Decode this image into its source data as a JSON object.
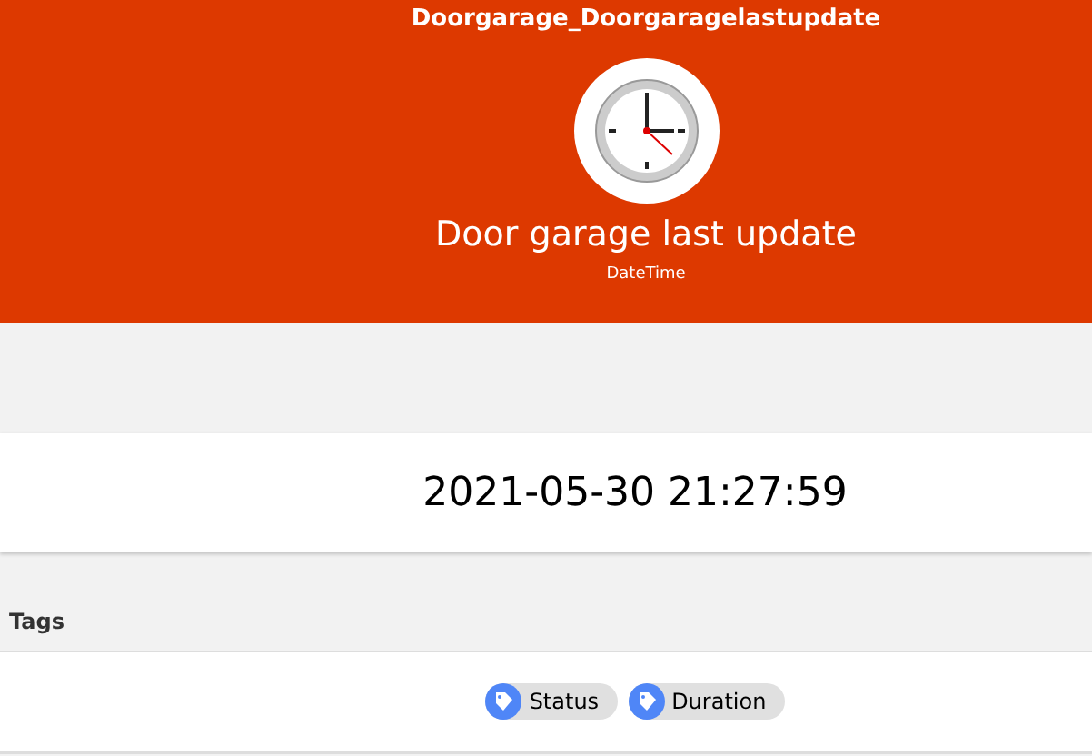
{
  "header": {
    "item_name": "Doorgarage_Doorgaragelastupdate",
    "label": "Door garage last update",
    "type": "DateTime"
  },
  "state": {
    "value": "2021-05-30 21:27:59"
  },
  "tags": {
    "heading": "Tags",
    "items": [
      {
        "label": "Status"
      },
      {
        "label": "Duration"
      }
    ]
  }
}
